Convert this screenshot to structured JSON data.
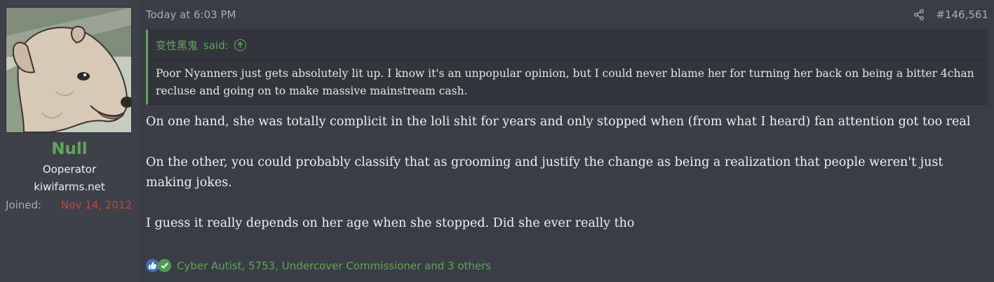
{
  "user": {
    "name": "Null",
    "title": "Ooperator",
    "site": "kiwifarms.net",
    "joined_label": "Joined:",
    "joined_date": "Nov 14, 2012"
  },
  "post": {
    "timestamp": "Today at 6:03 PM",
    "post_number": "#146,561",
    "quote": {
      "author": "变性黑鬼",
      "said": "said:",
      "text": "Poor Nyanners just gets absolutely lit up. I know it's an unpopular opinion, but I could never blame her for turning her back on being a bitter 4chan recluse and going on to make massive mainstream cash."
    },
    "paragraphs": [
      "On one hand, she was totally complicit in the loli shit for years and only stopped when (from what I heard) fan attention got too real",
      "On the other, you could probably classify that as grooming and justify the change as being a realization that people weren't just making jokes.",
      "I guess it really depends on her age when she stopped. Did she ever really tho"
    ],
    "reactions": {
      "icons": [
        "like-icon",
        "agree-icon"
      ],
      "text": "Cyber Autist, 5753, Undercover Commissioner and 3 others"
    }
  },
  "colors": {
    "accent_green": "#63a45e",
    "joined_red": "#c8463c",
    "background": "#3a3d45"
  }
}
